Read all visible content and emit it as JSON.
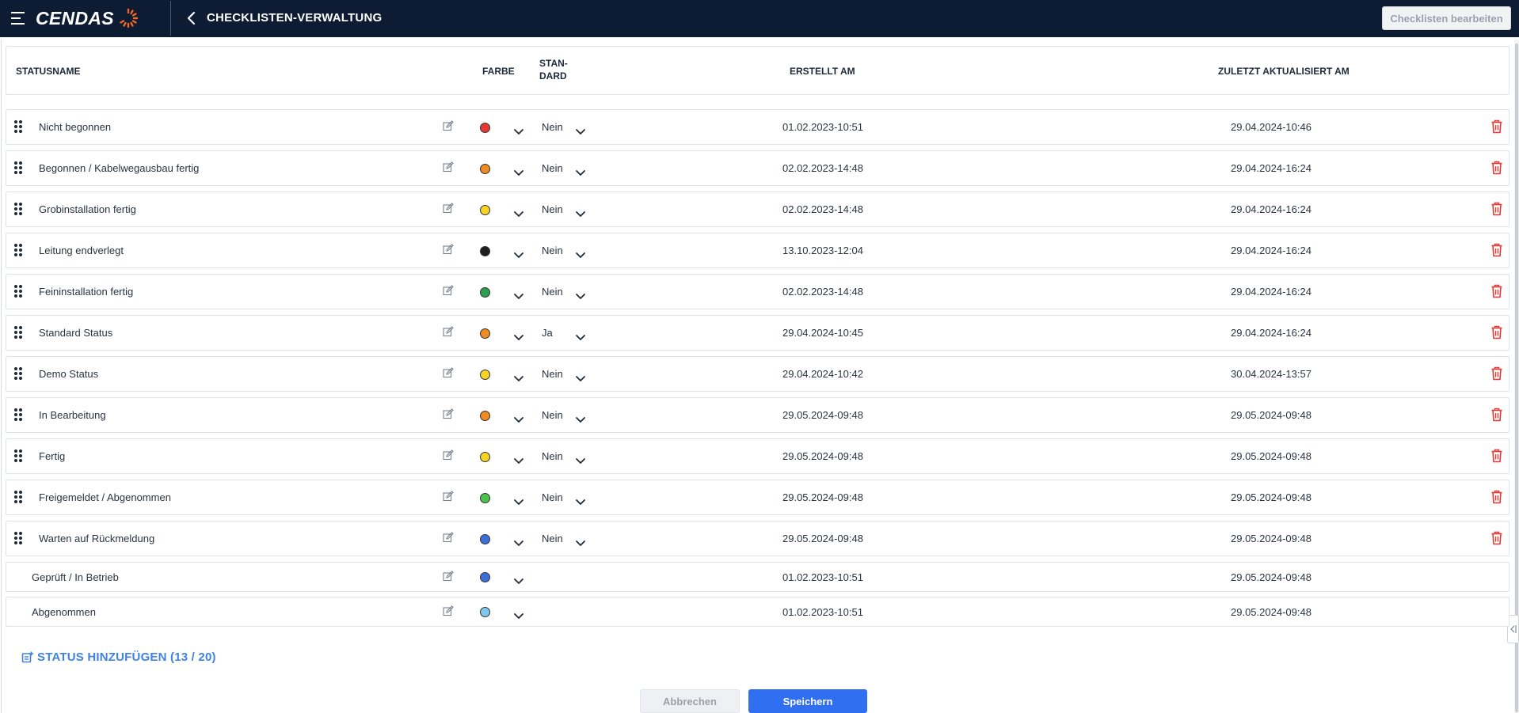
{
  "header": {
    "logo_text": "CENDAS",
    "title": "CHECKLISTEN-VERWALTUNG",
    "edit_button": "Checklisten bearbeiten"
  },
  "table": {
    "columns": {
      "name": "STATUSNAME",
      "color": "FARBE",
      "standard_line1": "STAN-",
      "standard_line2": "DARD",
      "created": "ERSTELLT AM",
      "updated": "ZULETZT AKTUALISIERT AM"
    },
    "rows": [
      {
        "name": "Nicht begonnen",
        "color": "#e53935",
        "standard": "Nein",
        "created": "01.02.2023-10:51",
        "updated": "29.04.2024-10:46"
      },
      {
        "name": "Begonnen / Kabelwegausbau fertig",
        "color": "#f08a24",
        "standard": "Nein",
        "created": "02.02.2023-14:48",
        "updated": "29.04.2024-16:24"
      },
      {
        "name": "Grobinstallation fertig",
        "color": "#f5d327",
        "standard": "Nein",
        "created": "02.02.2023-14:48",
        "updated": "29.04.2024-16:24"
      },
      {
        "name": "Leitung endverlegt",
        "color": "#1f1f1f",
        "standard": "Nein",
        "created": "13.10.2023-12:04",
        "updated": "29.04.2024-16:24"
      },
      {
        "name": "Feininstallation fertig",
        "color": "#2e9e4f",
        "standard": "Nein",
        "created": "02.02.2023-14:48",
        "updated": "29.04.2024-16:24"
      },
      {
        "name": "Standard Status",
        "color": "#f08a24",
        "standard": "Ja",
        "created": "29.04.2024-10:45",
        "updated": "29.04.2024-16:24"
      },
      {
        "name": "Demo Status",
        "color": "#f5d327",
        "standard": "Nein",
        "created": "29.04.2024-10:42",
        "updated": "30.04.2024-13:57"
      },
      {
        "name": "In Bearbeitung",
        "color": "#f08a24",
        "standard": "Nein",
        "created": "29.05.2024-09:48",
        "updated": "29.05.2024-09:48"
      },
      {
        "name": "Fertig",
        "color": "#f5d327",
        "standard": "Nein",
        "created": "29.05.2024-09:48",
        "updated": "29.05.2024-09:48"
      },
      {
        "name": "Freigemeldet / Abgenommen",
        "color": "#4cc44c",
        "standard": "Nein",
        "created": "29.05.2024-09:48",
        "updated": "29.05.2024-09:48"
      },
      {
        "name": "Warten auf Rückmeldung",
        "color": "#3b6fd8",
        "standard": "Nein",
        "created": "29.05.2024-09:48",
        "updated": "29.05.2024-09:48"
      }
    ],
    "system_rows": [
      {
        "name": "Geprüft / In Betrieb",
        "color": "#3b6fd8",
        "created": "01.02.2023-10:51",
        "updated": "29.05.2024-09:48"
      },
      {
        "name": "Abgenommen",
        "color": "#7ec8f0",
        "created": "01.02.2023-10:51",
        "updated": "29.05.2024-09:48"
      }
    ]
  },
  "add_status_label": "STATUS HINZUFÜGEN (13 / 20)",
  "footer": {
    "cancel": "Abbrechen",
    "save": "Speichern"
  },
  "colors": {
    "topbar": "#0d1b33",
    "accent": "#3f82e6",
    "save": "#2f6ff0",
    "danger": "#e53935",
    "logo_orange": "#f26a21"
  }
}
